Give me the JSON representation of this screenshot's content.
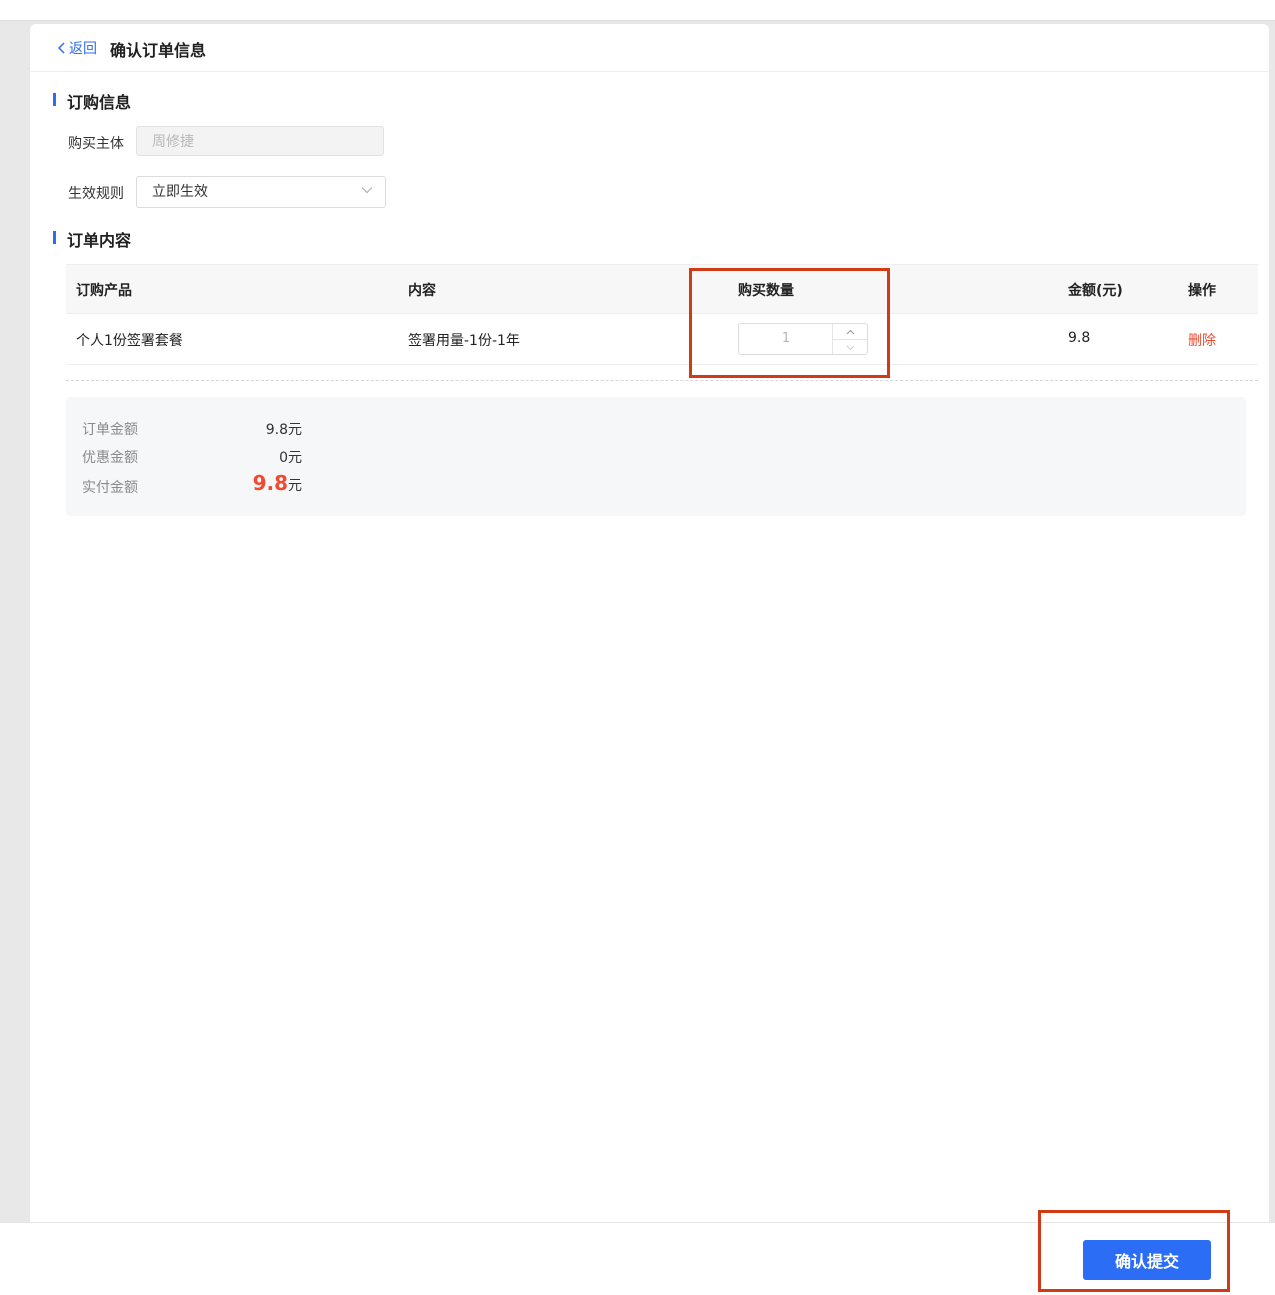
{
  "header": {
    "back_label": "返回",
    "title": "确认订单信息"
  },
  "order_info": {
    "section_title": "订购信息",
    "subject_label": "购买主体",
    "subject_value": "周修捷",
    "rule_label": "生效规则",
    "rule_value": "立即生效"
  },
  "order_content": {
    "section_title": "订单内容",
    "columns": [
      "订购产品",
      "内容",
      "购买数量",
      "金额(元)",
      "操作"
    ],
    "rows": [
      {
        "product": "个人1份签署套餐",
        "content": "签署用量-1份-1年",
        "quantity": "1",
        "amount": "9.8",
        "action": "删除"
      }
    ]
  },
  "summary": {
    "order_amount_label": "订单金额",
    "order_amount_value": "9.8元",
    "discount_label": "优惠金额",
    "discount_value": "0元",
    "paid_label": "实付金额",
    "paid_value": "9.8",
    "paid_unit": "元"
  },
  "footer": {
    "submit_label": "确认提交"
  },
  "colors": {
    "accent": "#2b6df5",
    "danger": "#f04b30",
    "highlight_box": "#d03b16"
  },
  "icons": {
    "back": "chevron-left-icon",
    "select": "chevron-down-icon",
    "stepper_up": "chevron-up-icon",
    "stepper_down": "chevron-down-icon"
  }
}
